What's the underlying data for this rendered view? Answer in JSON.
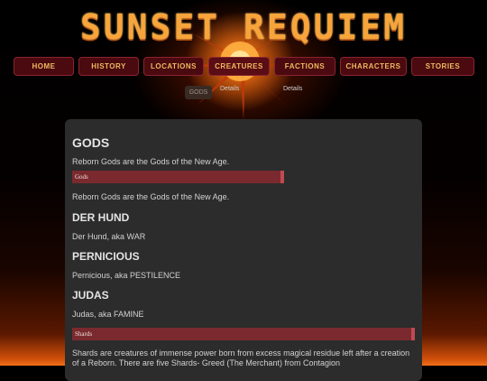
{
  "site": {
    "title": "SUNSET REQUIEM"
  },
  "nav": [
    {
      "label": "HOME"
    },
    {
      "label": "HISTORY"
    },
    {
      "label": "LOCATIONS"
    },
    {
      "label": "CREATURES"
    },
    {
      "label": "FACTIONS"
    },
    {
      "label": "CHARACTERS"
    },
    {
      "label": "STORIES"
    }
  ],
  "subnav": {
    "current": "GODS",
    "details_left": "Details",
    "details_right": "Details"
  },
  "content": {
    "heading": "GODS",
    "intro": "Reborn Gods are the Gods of the New Age.",
    "gods_bar": "Gods",
    "gods_desc": "Reborn Gods are the Gods of the New Age.",
    "entries": [
      {
        "name": "DER HUND",
        "desc": "Der Hund, aka WAR"
      },
      {
        "name": "PERNICIOUS",
        "desc": "Pernicious, aka PESTILENCE"
      },
      {
        "name": "JUDAS",
        "desc": "Judas, aka FAMINE"
      }
    ],
    "shards_bar": "Shards",
    "shards_desc": "Shards are creatures of immense power born from excess magical residue left after a creation of a Reborn. There are five Shards- Greed (The Merchant) from Contagion"
  },
  "colors": {
    "accent": "#f7a43a",
    "nav_bg": "#4a0a0f",
    "bar": "#7a2a2e",
    "panel": "#2c2c2c"
  }
}
